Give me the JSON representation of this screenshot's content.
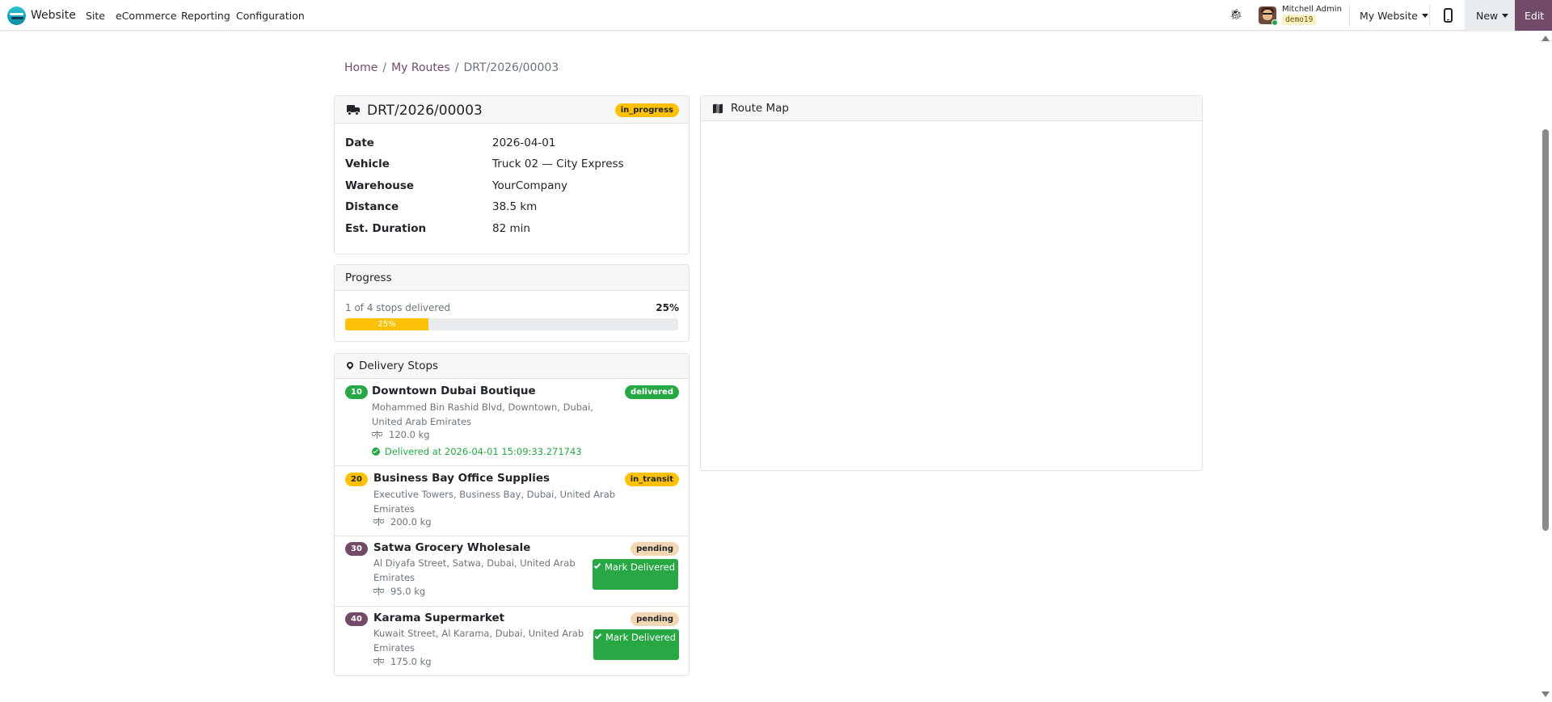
{
  "navbar": {
    "app_name": "Website",
    "menu": [
      "Site",
      "eCommerce",
      "Reporting",
      "Configuration"
    ],
    "user_name": "Mitchell Admin",
    "db_name": "demo19",
    "website_selector": "My Website",
    "new_label": "New",
    "edit_label": "Edit",
    "icons": [
      "bug-icon",
      "avatar",
      "mobile-preview-icon"
    ]
  },
  "breadcrumb": {
    "home": "Home",
    "routes": "My Routes",
    "current": "DRT/2026/00003",
    "separator": "/"
  },
  "route": {
    "title": "DRT/2026/00003",
    "status": "in_progress",
    "fields": [
      {
        "label": "Date",
        "value": "2026-04-01"
      },
      {
        "label": "Vehicle",
        "value": "Truck 02 — City Express"
      },
      {
        "label": "Warehouse",
        "value": "YourCompany"
      },
      {
        "label": "Distance",
        "value": "38.5 km"
      },
      {
        "label": "Est. Duration",
        "value": "82 min"
      }
    ]
  },
  "progress": {
    "title": "Progress",
    "summary": "1 of 4 stops delivered",
    "percent_label": "25%",
    "bar_label": "25%",
    "fraction": 0.25
  },
  "stops": {
    "title": "Delivery Stops",
    "mark_label": "Mark Delivered",
    "items": [
      {
        "seq": "10",
        "name": "Downtown Dubai Boutique",
        "address": "Mohammed Bin Rashid Blvd, Downtown, Dubai, United Arab Emirates",
        "weight": "120.0 kg",
        "status": "delivered",
        "delivered_at": "Delivered at 2026-04-01 15:09:33.271743"
      },
      {
        "seq": "20",
        "name": "Business Bay Office Supplies",
        "address": "Executive Towers, Business Bay, Dubai, United Arab Emirates",
        "weight": "200.0 kg",
        "status": "in_transit"
      },
      {
        "seq": "30",
        "name": "Satwa Grocery Wholesale",
        "address": "Al Diyafa Street, Satwa, Dubai, United Arab Emirates",
        "weight": "95.0 kg",
        "status": "pending"
      },
      {
        "seq": "40",
        "name": "Karama Supermarket",
        "address": "Kuwait Street, Al Karama, Dubai, United Arab Emirates",
        "weight": "175.0 kg",
        "status": "pending"
      }
    ]
  },
  "map": {
    "title": "Route Map"
  },
  "colors": {
    "brand": "#714b67",
    "success": "#28a745",
    "warning": "#ffc107",
    "pending": "#f3d6b3"
  }
}
